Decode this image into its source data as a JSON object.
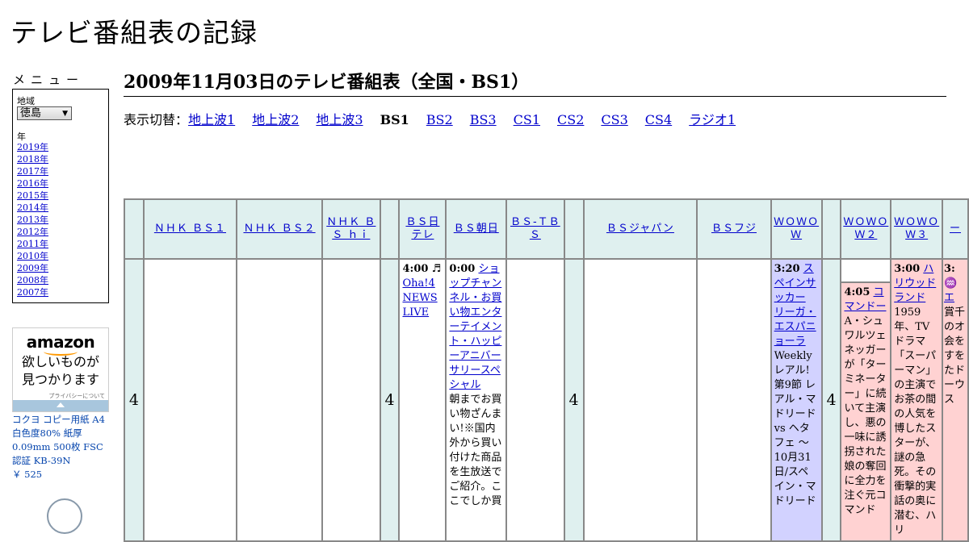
{
  "site": {
    "title": "テレビ番組表の記録"
  },
  "menu": {
    "heading": "メニュー",
    "region_label": "地域",
    "region_value": "徳島",
    "year_label": "年",
    "years": [
      "2019年",
      "2018年",
      "2017年",
      "2016年",
      "2015年",
      "2014年",
      "2013年",
      "2012年",
      "2011年",
      "2010年",
      "2009年",
      "2008年",
      "2007年"
    ]
  },
  "ad": {
    "logo": "amazon",
    "text_line1": "欲しいものが",
    "text_line2": "見つかります",
    "privacy": "プライバシーについて",
    "product": "コクヨ コピー用紙 A4 白色度80% 紙厚0.09mm 500枚 FSC認証 KB-39N",
    "price": "￥ 525"
  },
  "page": {
    "title": "2009年11月03日のテレビ番組表（全国・BS1）"
  },
  "switcher": {
    "label": "表示切替：",
    "items": [
      {
        "label": "地上波1",
        "current": false
      },
      {
        "label": "地上波2",
        "current": false
      },
      {
        "label": "地上波3",
        "current": false
      },
      {
        "label": "BS1",
        "current": true
      },
      {
        "label": "BS2",
        "current": false
      },
      {
        "label": "BS3",
        "current": false
      },
      {
        "label": "CS1",
        "current": false
      },
      {
        "label": "CS2",
        "current": false
      },
      {
        "label": "CS3",
        "current": false
      },
      {
        "label": "CS4",
        "current": false
      },
      {
        "label": "ラジオ1",
        "current": false
      }
    ]
  },
  "grid": {
    "hour": "4",
    "channels": [
      "ＮＨＫ ＢＳ１",
      "ＮＨＫ ＢＳ２",
      "ＮＨＫ ＢＳ ｈｉ",
      "ＢＳ日テレ",
      "ＢＳ朝日",
      "ＢＳ-ＴＢＳ",
      "ＢＳジャパン",
      "ＢＳフジ",
      "ＷＯＷＯＷ",
      "ＷＯＷＯＷ２",
      "ＷＯＷＯＷ３",
      "ー"
    ],
    "programs": {
      "bs_nittele": {
        "time": "4:00",
        "icon": "music-note-icon",
        "title": "Oha!4 NEWS LIVE"
      },
      "bs_asahi": {
        "time": "0:00",
        "title": "ショップチャンネル・お買い物エンターテイメント・ハッピーアニバーサリースペシャル",
        "desc": "朝までお買い物ざんまい!※国内外から買い付けた商品を生放送でご紹介。ここでしか買"
      },
      "wowow": {
        "time": "3:20",
        "title": "スペインサッカー リーガ・エスパニョーラ",
        "desc": "Weeklyレアル! 第9節 レアル・マドリード vs ヘタフェ ～10月31日/スペイン・マドリード"
      },
      "wowow2": {
        "time": "4:05",
        "title": "コマンドー",
        "desc": "A・シュワルツェネッガーが「ターミネーター」に続いて主演し、悪の一味に誘拐された娘の奪回に全力を注ぐ元コマンド"
      },
      "wowow3": {
        "time": "3:00",
        "title": "ハリウッドランド",
        "desc": "1959年、TVドラマ「スーパーマン」の主演でお茶の間の人気を博したスターが、謎の急死。その衝撃的実話の奥に潜む、ハリ"
      },
      "extra": {
        "time": "3:",
        "title": "エ",
        "desc": "賞千のオ会をすをたドーウス"
      }
    }
  },
  "colors": {
    "header_bg": "#dff0ef",
    "wowow_bg": "#d2d2ff",
    "pink_bg": "#ffd2d2",
    "link": "#0000cc"
  }
}
